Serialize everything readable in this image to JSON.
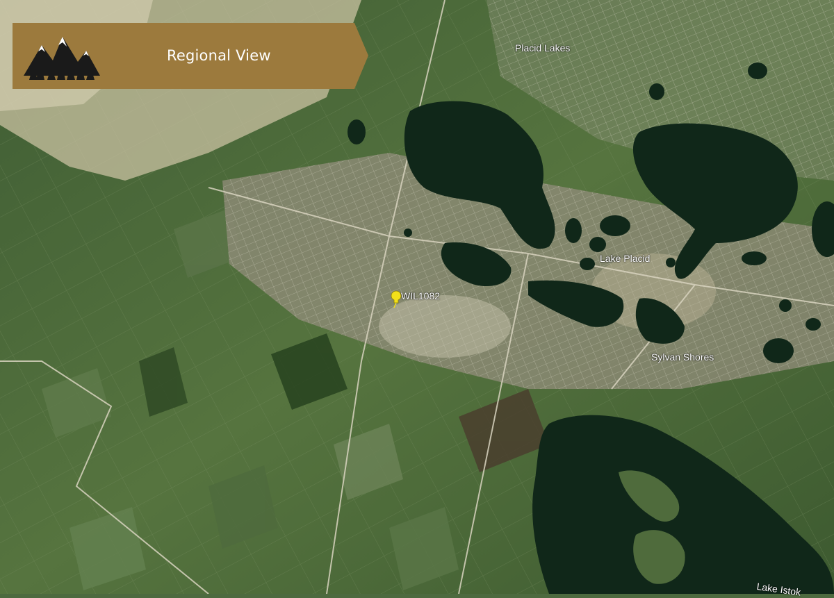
{
  "banner": {
    "title": "Regional View",
    "background_color": "#9c7a3d",
    "logo_icon": "mountains-trees-logo"
  },
  "marker": {
    "label": "WIL1082",
    "icon": "yellow-pushpin-icon",
    "color": "#f2e01a"
  },
  "places": [
    {
      "name": "Placid Lakes"
    },
    {
      "name": "Lake Placid"
    },
    {
      "name": "Sylvan Shores"
    },
    {
      "name": "Lake Istok"
    }
  ],
  "colors": {
    "water": "#102719",
    "farmland": "#4d6a3f",
    "urban": "#9c9a86"
  }
}
